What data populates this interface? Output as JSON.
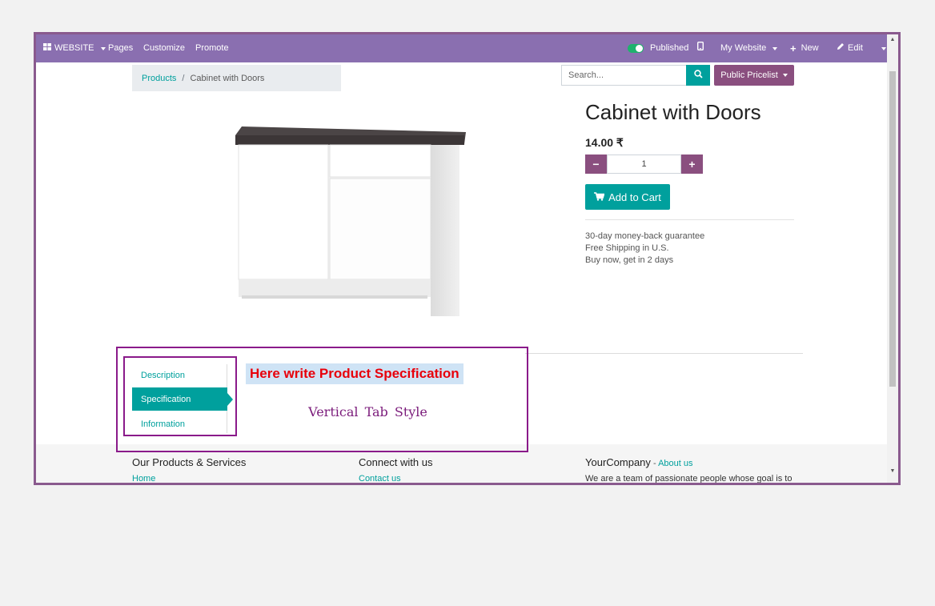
{
  "navbar": {
    "website_label": "WEBSITE",
    "pages": "Pages",
    "customize": "Customize",
    "promote": "Promote",
    "published": "Published",
    "my_website": "My Website",
    "new": "New",
    "edit": "Edit"
  },
  "breadcrumb": {
    "parent": "Products",
    "separator": "/",
    "current": "Cabinet with Doors"
  },
  "search": {
    "placeholder": "Search..."
  },
  "pricelist": {
    "label": "Public Pricelist"
  },
  "product": {
    "name": "Cabinet with Doors",
    "price": "14.00 ₹",
    "quantity": "1",
    "minus": "−",
    "plus": "+",
    "add_to_cart": "Add to Cart",
    "guarantee_lines": [
      "30-day money-back guarantee",
      "Free Shipping in U.S.",
      "Buy now, get in 2 days"
    ]
  },
  "tabs": {
    "items": [
      "Description",
      "Specification",
      "Information"
    ],
    "active_index": 1,
    "content_heading": "Here write Product Specification",
    "style_caption": "Vertical  Tab  Style"
  },
  "footer": {
    "col1_title": "Our Products & Services",
    "col1_link": "Home",
    "col2_title": "Connect with us",
    "col2_link": "Contact us",
    "col3_title": "YourCompany",
    "col3_sep": " - ",
    "col3_link": "About us",
    "col3_text": "We are a team of passionate people whose goal is to"
  },
  "colors": {
    "navbar": "#8a6fb0",
    "accent": "#00a09d",
    "secondary": "#8a4f7f",
    "highlight_text": "#e8000b",
    "frame_border": "#8a1a8a"
  },
  "icons": [
    "apps-grid-icon",
    "mobile-icon",
    "plus-icon",
    "pencil-icon",
    "search-icon",
    "cart-icon",
    "toggle-icon"
  ]
}
